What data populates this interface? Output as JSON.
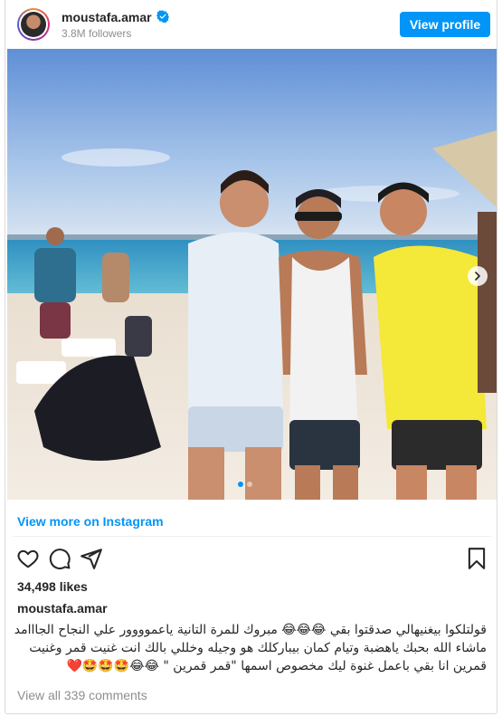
{
  "profile": {
    "username": "moustafa.amar",
    "followers": "3.8M followers",
    "view_profile_label": "View profile",
    "verified": true
  },
  "post": {
    "carousel_dots": 2,
    "active_dot": 0,
    "view_more_label": "View more on Instagram",
    "likes": "34,498 likes",
    "owner": "moustafa.amar",
    "caption": "قولتلكوا بيغنيهالي صدقتوا بقي 😂😂😂 مبروك للمرة التانية ياعموووور علي النجاح الجااامد ماشاء الله بحبك ياهضبة وتيام كمان بيباركلك هو وجيله وخللي بالك انت غنيت قمر وغنيت قمرين انا بقي باعمل غنوة ليك مخصوص اسمها \"قمر قمرين \" 😂😂🤩🤩🤩❤️",
    "comments_label": "View all 339 comments"
  },
  "colors": {
    "accent": "#0095f6",
    "muted": "#8e8e8e",
    "text": "#262626"
  },
  "icons": [
    "verified-badge-icon",
    "heart-icon",
    "comment-icon",
    "share-icon",
    "bookmark-icon",
    "chevron-right-icon"
  ]
}
